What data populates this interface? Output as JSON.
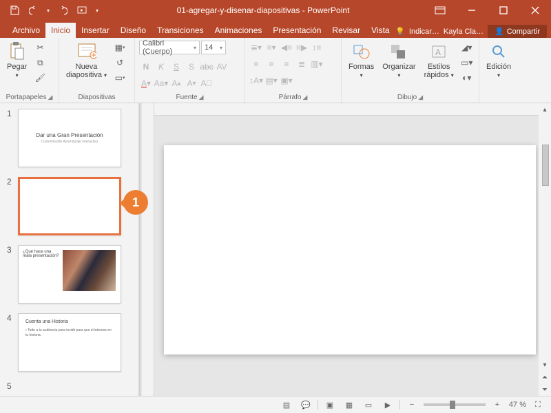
{
  "titlebar": {
    "filename": "01-agregar-y-disenar-diapositivas",
    "app": "PowerPoint"
  },
  "tabs": {
    "file": "Archivo",
    "home": "Inicio",
    "insert": "Insertar",
    "design": "Diseño",
    "transitions": "Transiciones",
    "animations": "Animaciones",
    "slideshow": "Presentación",
    "review": "Revisar",
    "view": "Vista",
    "tellme": "Indicar…",
    "user": "Kayla Cla…",
    "share": "Compartir"
  },
  "ribbon": {
    "clipboard": {
      "paste": "Pegar",
      "label": "Portapapeles"
    },
    "slides": {
      "new_slide": "Nueva\ndiapositiva",
      "label": "Diapositivas"
    },
    "font": {
      "name": "Calibri (Cuerpo)",
      "size": "14",
      "label": "Fuente"
    },
    "paragraph": {
      "label": "Párrafo"
    },
    "drawing": {
      "shapes": "Formas",
      "arrange": "Organizar",
      "quick_styles": "Estilos\nrápidos",
      "label": "Dibujo"
    },
    "editing": {
      "edit": "Edición",
      "label": ""
    }
  },
  "thumbs": [
    {
      "n": "1",
      "title": "Dar una Gran Presentación",
      "sub": "CustomGuide Aprendizaje Interactivo"
    },
    {
      "n": "2"
    },
    {
      "n": "3",
      "title": "¿Qué hace una mala presentación?"
    },
    {
      "n": "4",
      "title": "Cuenta una Historia",
      "bullet": "• Todo a tu audiencia para incidir para que el interese en tu historia."
    },
    {
      "n": "5"
    }
  ],
  "status": {
    "zoom": "47 %"
  },
  "callout": {
    "num": "1"
  }
}
